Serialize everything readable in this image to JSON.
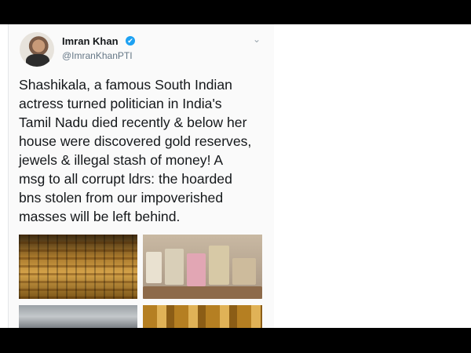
{
  "tweet": {
    "author_name": "Imran Khan",
    "verified_badge": "✔",
    "handle": "@ImranKhanPTI",
    "menu_icon": "chevron-down-icon",
    "text": "Shashikala, a famous South Indian\nactress turned politician in India's\nTamil Nadu died recently & below her\nhouse were discovered gold reserves,\njewels & illegal stash of money! A\nmsg to all  corrupt ldrs: the hoarded\nbns stolen from our impoverished\nmasses will be left behind."
  },
  "colors": {
    "verified": "#1da1f2",
    "text": "#14171a",
    "muted": "#657786"
  }
}
